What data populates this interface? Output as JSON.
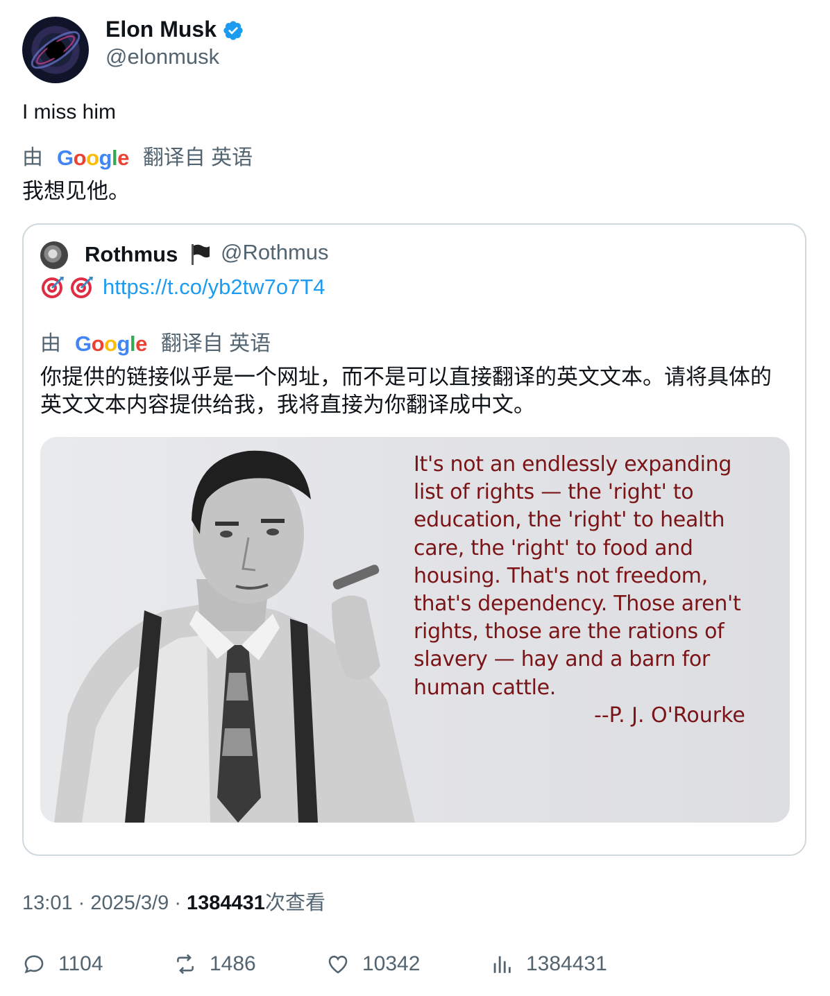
{
  "author": {
    "name": "Elon Musk",
    "handle": "@elonmusk",
    "verified_icon": "verified-badge-icon",
    "verified_color": "#1d9bf0"
  },
  "tweet": {
    "text": "I miss him",
    "translation": {
      "by": "由",
      "engine": "Google",
      "from_label": "翻译自 英语",
      "text": "我想见他。"
    }
  },
  "quoted": {
    "name": "Rothmus",
    "flag_icon": "black-flag-icon",
    "handle": "@Rothmus",
    "emoji_icon": "target-icon",
    "link": "https://t.co/yb2tw7o7T4",
    "translation": {
      "by": "由",
      "engine": "Google",
      "from_label": "翻译自 英语",
      "text": "你提供的链接似乎是一个网址，而不是可以直接翻译的英文文本。请将具体的英文文本内容提供给我，我将直接为你翻译成中文。"
    },
    "image": {
      "quote_lines": [
        "It's not an endlessly expanding",
        "list of rights — the 'right' to",
        "education, the 'right' to health",
        "care, the 'right' to food and",
        "housing. That's not freedom,",
        "that's dependency. Those aren't",
        "rights, those are the rations of",
        "slavery — hay and a barn for",
        "human cattle."
      ],
      "attribution": "--P. J. O'Rourke",
      "quote_color": "#7a1417"
    }
  },
  "meta": {
    "time": "13:01",
    "date": "2025/3/9",
    "views_count": "1384431",
    "views_label": "次查看"
  },
  "actions": {
    "replies": "1104",
    "reposts": "1486",
    "likes": "10342",
    "views": "1384431"
  }
}
